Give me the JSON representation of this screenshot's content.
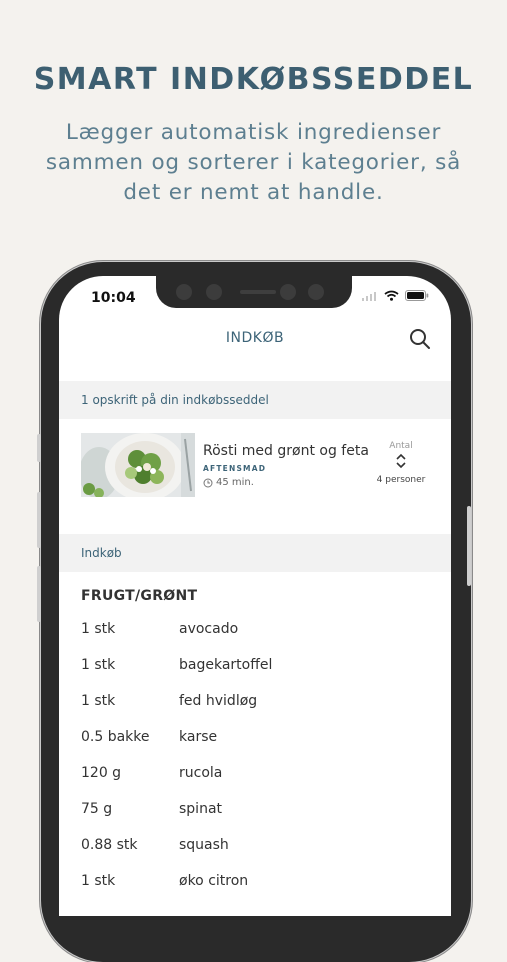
{
  "promo": {
    "title": "SMART INDKØBSSEDDEL",
    "subtitle_line1": "Lægger automatisk ingredienser",
    "subtitle_line2": "sammen og sorterer i kategorier, så",
    "subtitle_line3": "det er nemt at handle."
  },
  "status_bar": {
    "time": "10:04"
  },
  "nav": {
    "title": "INDKØB"
  },
  "recipes_section": {
    "header": "1 opskrift på din indkøbsseddel",
    "recipe": {
      "name": "Rösti med grønt og feta",
      "tag": "AFTENSMAD",
      "time": "45 min.",
      "amount_label": "Antal",
      "persons": "4 personer"
    }
  },
  "shopping_section": {
    "header": "Indkøb",
    "category": "FRUGT/GRØNT",
    "items": [
      {
        "qty": "1 stk",
        "name": "avocado"
      },
      {
        "qty": "1 stk",
        "name": "bagekartoffel"
      },
      {
        "qty": "1 stk",
        "name": "fed hvidløg"
      },
      {
        "qty": "0.5 bakke",
        "name": "karse"
      },
      {
        "qty": "120 g",
        "name": "rucola"
      },
      {
        "qty": "75 g",
        "name": "spinat"
      },
      {
        "qty": "0.88 stk",
        "name": "squash"
      },
      {
        "qty": "1 stk",
        "name": "øko citron"
      }
    ]
  },
  "colors": {
    "accent": "#3d6478",
    "background": "#f4f2ee",
    "section_bar": "#f2f2f2"
  }
}
